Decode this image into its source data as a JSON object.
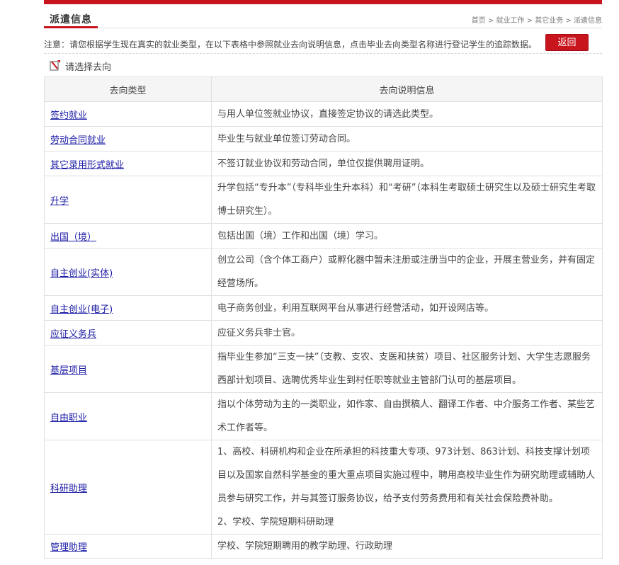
{
  "header": {
    "title": "派遣信息",
    "breadcrumb": [
      "首页",
      "就业工作",
      "其它业务",
      "派遣信息"
    ],
    "breadcrumb_sep": ">"
  },
  "notice": {
    "text": "注意：请您根据学生现在真实的就业类型，在以下表格中参照就业去向说明信息，点击毕业去向类型名称进行登记学生的追踪数据。",
    "back_label": "返回"
  },
  "choose": {
    "label": "请选择去向"
  },
  "table": {
    "headers": {
      "type": "去向类型",
      "desc": "去向说明信息"
    },
    "rows": [
      {
        "type": "签约就业",
        "desc": [
          "与用人单位签就业协议，直接签定协议的请选此类型。"
        ]
      },
      {
        "type": "劳动合同就业",
        "desc": [
          "毕业生与就业单位签订劳动合同。"
        ]
      },
      {
        "type": "其它录用形式就业",
        "desc": [
          "不签订就业协议和劳动合同，单位仅提供聘用证明。"
        ]
      },
      {
        "type": "升学",
        "desc": [
          "升学包括“专升本”（专科毕业生升本科）和“考研”（本科生考取硕士研究生以及硕士研究生考取博士研究生）。"
        ]
      },
      {
        "type": "出国（境）",
        "desc": [
          "包括出国（境）工作和出国（境）学习。"
        ]
      },
      {
        "type": "自主创业(实体)",
        "desc": [
          "创立公司（含个体工商户）或孵化器中暂未注册或注册当中的企业，开展主营业务，并有固定经营场所。"
        ]
      },
      {
        "type": "自主创业(电子)",
        "desc": [
          "电子商务创业，利用互联网平台从事进行经营活动，如开设网店等。"
        ]
      },
      {
        "type": "应征义务兵",
        "desc": [
          "应征义务兵非士官。"
        ]
      },
      {
        "type": "基层项目",
        "desc": [
          "指毕业生参加“三支一扶”（支教、支农、支医和扶贫）项目、社区服务计划、大学生志愿服务西部计划项目、选聘优秀毕业生到村任职等就业主管部门认可的基层项目。"
        ]
      },
      {
        "type": "自由职业",
        "desc": [
          "指以个体劳动为主的一类职业，如作家、自由撰稿人、翻译工作者、中介服务工作者、某些艺术工作者等。"
        ]
      },
      {
        "type": "科研助理",
        "desc": [
          "1、高校、科研机构和企业在所承担的科技重大专项、973计划、863计划、科技支撑计划项目以及国家自然科学基金的重大重点项目实施过程中，聘用高校毕业生作为研究助理或辅助人员参与研究工作，并与其签订服务协议，给予支付劳务费用和有关社会保险费补助。",
          "2、学校、学院短期科研助理"
        ]
      },
      {
        "type": "管理助理",
        "desc": [
          "学校、学院短期聘用的教学助理、行政助理"
        ]
      }
    ]
  }
}
